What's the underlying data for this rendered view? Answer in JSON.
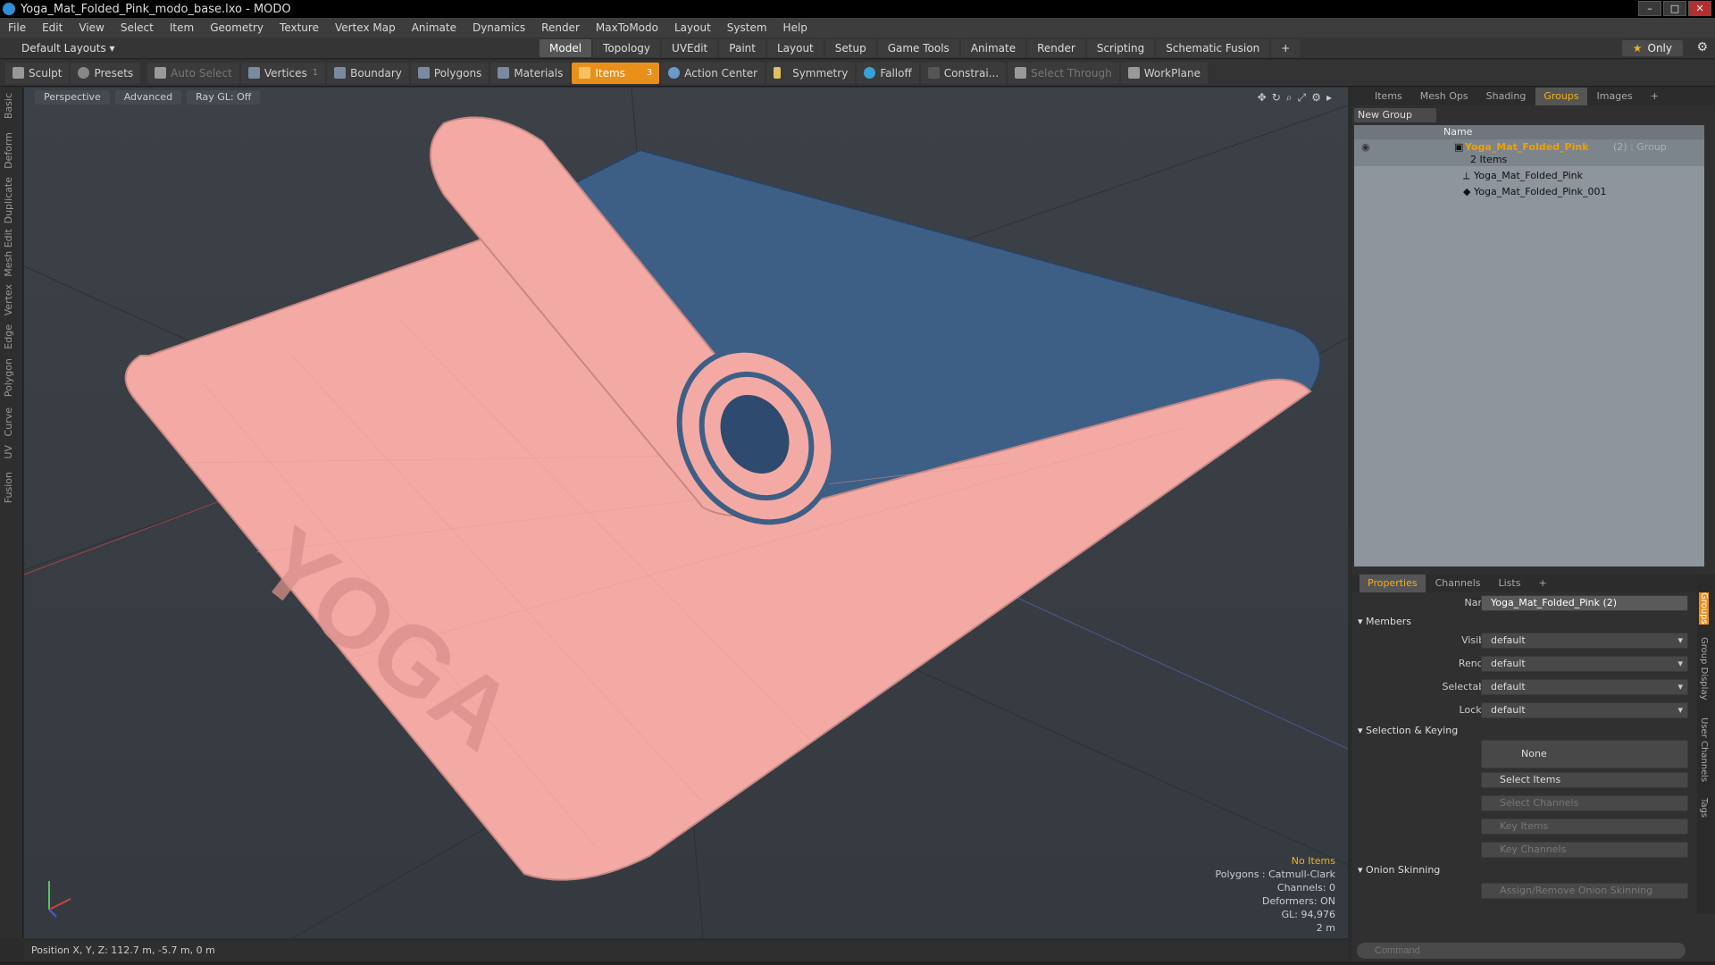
{
  "window": {
    "title": "Yoga_Mat_Folded_Pink_modo_base.lxo - MODO",
    "buttons": [
      "–",
      "□",
      "✕"
    ]
  },
  "menu": [
    "File",
    "Edit",
    "View",
    "Select",
    "Item",
    "Geometry",
    "Texture",
    "Vertex Map",
    "Animate",
    "Dynamics",
    "Render",
    "MaxToModo",
    "Layout",
    "System",
    "Help"
  ],
  "layoutbar": {
    "default_layouts": "Default Layouts ▾",
    "tabs": [
      "Model",
      "Topology",
      "UVEdit",
      "Paint",
      "Layout",
      "Setup",
      "Game Tools",
      "Animate",
      "Render",
      "Scripting",
      "Schematic Fusion",
      "+"
    ],
    "only": "Only"
  },
  "toolbar": {
    "sculpt": "Sculpt",
    "presets": "Presets",
    "auto_select": "Auto Select",
    "vertices": "Vertices",
    "vertices_count": "1",
    "boundary": "Boundary",
    "polygons": "Polygons",
    "materials": "Materials",
    "items": "Items",
    "items_count": "3",
    "action_center": "Action Center",
    "symmetry": "Symmetry",
    "falloff": "Falloff",
    "constraints": "Constrai...",
    "select_through": "Select Through",
    "workplane": "WorkPlane"
  },
  "left_tabs": [
    "Basic",
    "Deform",
    "Duplicate",
    "Mesh Edit",
    "Vertex",
    "Edge",
    "Polygon",
    "Curve",
    "UV",
    "Fusion"
  ],
  "viewport": {
    "view": "Perspective",
    "mode": "Advanced",
    "raygl": "Ray GL: Off",
    "mat_label": "YOGA",
    "hud": {
      "noitems": "No Items",
      "polygons": "Polygons : Catmull-Clark",
      "channels": "Channels: 0",
      "deformers": "Deformers: ON",
      "gl": "GL: 94,976",
      "scale": "2 m"
    },
    "colors": {
      "pink": "#f4aaa4",
      "blue": "#3e5f85",
      "bg": "#383d43"
    }
  },
  "status": {
    "position": "Position X, Y, Z:  112.7 m, -5.7 m, 0 m"
  },
  "groups_panel": {
    "tabs": [
      "Items",
      "Mesh Ops",
      "Shading",
      "Groups",
      "Images",
      "+"
    ],
    "active_tab": "Groups",
    "new_group": "New Group",
    "column": "Name",
    "group": {
      "name": "Yoga_Mat_Folded_Pink",
      "tag": "(2) : Group",
      "count": "2 Items"
    },
    "children": [
      "Yoga_Mat_Folded_Pink",
      "Yoga_Mat_Folded_Pink_001"
    ]
  },
  "properties": {
    "tabs": [
      "Properties",
      "Channels",
      "Lists",
      "+"
    ],
    "name_label": "Name",
    "name_value": "Yoga_Mat_Folded_Pink (2)",
    "members": "Members",
    "visible_label": "Visible",
    "visible": "default",
    "render_label": "Render",
    "render": "default",
    "selectable_label": "Selectable",
    "selectable": "default",
    "locked_label": "Locked",
    "locked": "default",
    "sel_keying": "Selection & Keying",
    "none": "None",
    "select_items": "Select Items",
    "select_channels": "Select Channels",
    "key_items": "Key Items",
    "key_channels": "Key Channels",
    "onion": "Onion Skinning",
    "assign_onion": "Assign/Remove Onion Skinning",
    "side_tabs": [
      "Groups",
      "Group Display",
      "User Channels",
      "Tags"
    ]
  },
  "command": {
    "placeholder": "Command"
  }
}
